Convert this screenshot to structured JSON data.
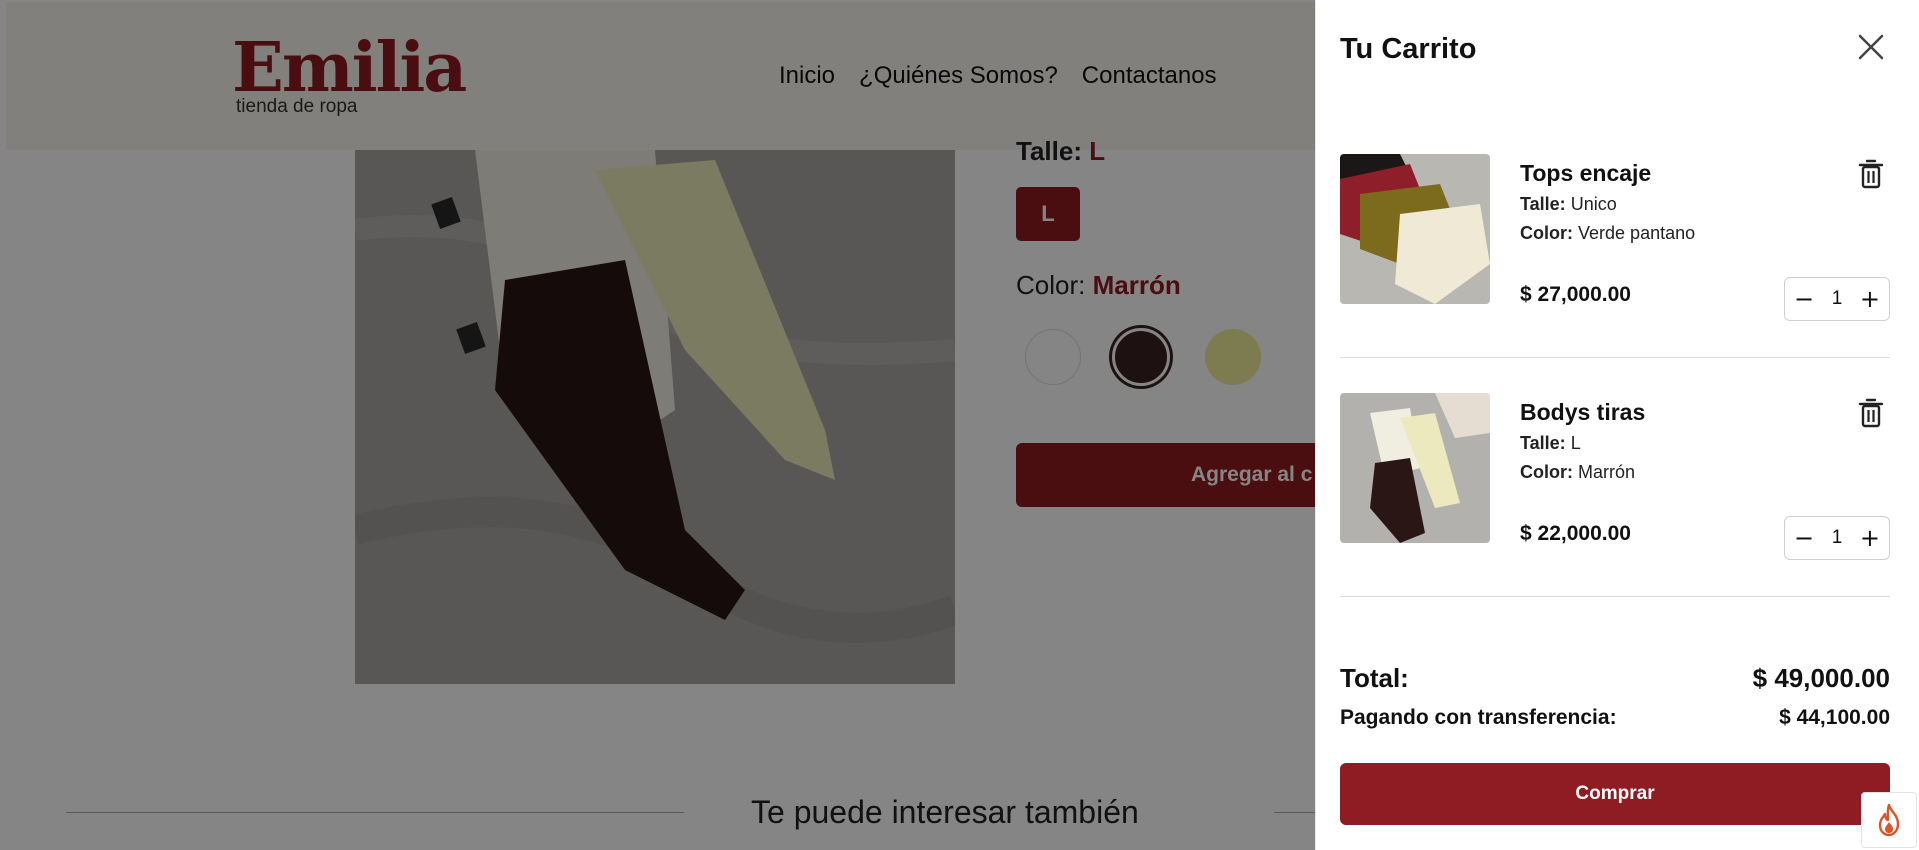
{
  "site": {
    "logo_word": "Emilia",
    "logo_sub": "tienda de ropa",
    "nav": [
      "Inicio",
      "¿Quiénes Somos?",
      "Contactanos"
    ]
  },
  "product": {
    "talle_label": "Talle:",
    "talle_value": "L",
    "size_option": "L",
    "color_label": "Color:",
    "color_value": "Marrón",
    "swatches": [
      "#ffffff",
      "#3b2222",
      "#efec9a"
    ],
    "add_to_cart": "Agregar al c"
  },
  "related": {
    "title": "Te puede interesar también"
  },
  "cart": {
    "title": "Tu Carrito",
    "items": [
      {
        "name": "Tops encaje",
        "talle_label": "Talle:",
        "talle": "Unico",
        "color_label": "Color:",
        "color": "Verde pantano",
        "price": "$ 27,000.00",
        "quantity": "1"
      },
      {
        "name": "Bodys tiras",
        "talle_label": "Talle:",
        "talle": "L",
        "color_label": "Color:",
        "color": "Marrón",
        "price": "$ 22,000.00",
        "quantity": "1"
      }
    ],
    "total_label": "Total:",
    "total_value": "$ 49,000.00",
    "transfer_label": "Pagando con transferencia:",
    "transfer_value": "$ 44,100.00",
    "buy_label": "Comprar"
  },
  "colors": {
    "brand": "#8e1c22",
    "overlay": "rgba(0,0,0,0.48)"
  }
}
